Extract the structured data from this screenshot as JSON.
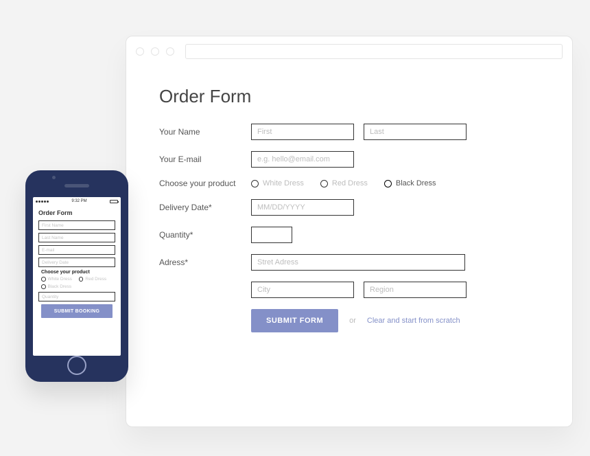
{
  "desktop": {
    "title": "Order Form",
    "labels": {
      "name": "Your Name",
      "email": "Your E-mail",
      "product": "Choose your product",
      "date": "Delivery Date*",
      "qty": "Quantity*",
      "address": "Adress*"
    },
    "placeholders": {
      "first": "First",
      "last": "Last",
      "email": "e.g. hello@email.com",
      "date": "MM/DD/YYYY",
      "street": "Stret Adress",
      "city": "City",
      "region": "Region"
    },
    "products": {
      "white": "White Dress",
      "red": "Red Dress",
      "black": "Black Dress"
    },
    "actions": {
      "submit": "SUBMIT FORM",
      "or": "or",
      "clear": "Clear and start from scratch"
    }
  },
  "mobile": {
    "status_time": "9:32 PM",
    "title": "Order Form",
    "placeholders": {
      "first": "First Name",
      "last": "Last Name",
      "email": "E-mail",
      "date": "Delivery Date",
      "qty": "Quantity"
    },
    "product_label": "Choose your product",
    "products": {
      "white": "White Dress",
      "red": "Red Dress",
      "black": "Black Dress"
    },
    "submit": "SUBMIT BOOKING"
  }
}
